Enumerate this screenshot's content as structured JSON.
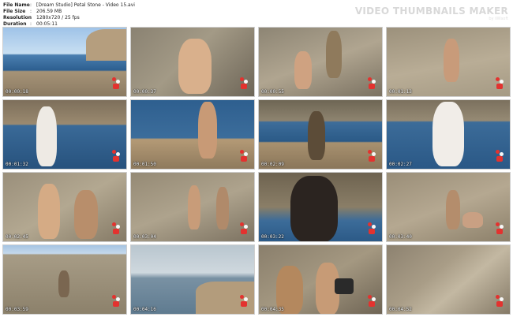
{
  "header": {
    "rows": [
      {
        "key": "File Name",
        "value": "[Dream Studio] Petal Stone - Video 15.avi"
      },
      {
        "key": "File Size",
        "value": "206.59 MB"
      },
      {
        "key": "Resolution",
        "value": "1280x720 / 25 fps"
      },
      {
        "key": "Duration",
        "value": "00:05:11"
      }
    ]
  },
  "watermark": {
    "title": "VIDEO THUMBNAILS MAKER",
    "subtitle": "by iWisoft"
  },
  "thumbnails": [
    {
      "timestamp": "00:00:18"
    },
    {
      "timestamp": "00:00:37"
    },
    {
      "timestamp": "00:00:55"
    },
    {
      "timestamp": "00:01:13"
    },
    {
      "timestamp": "00:01:32"
    },
    {
      "timestamp": "00:01:50"
    },
    {
      "timestamp": "00:02:09"
    },
    {
      "timestamp": "00:02:27"
    },
    {
      "timestamp": "00:02:45"
    },
    {
      "timestamp": "00:03:04"
    },
    {
      "timestamp": "00:03:22"
    },
    {
      "timestamp": "00:03:40"
    },
    {
      "timestamp": "00:03:59"
    },
    {
      "timestamp": "00:04:16"
    },
    {
      "timestamp": "00:04:35"
    },
    {
      "timestamp": "00:04:52"
    }
  ]
}
